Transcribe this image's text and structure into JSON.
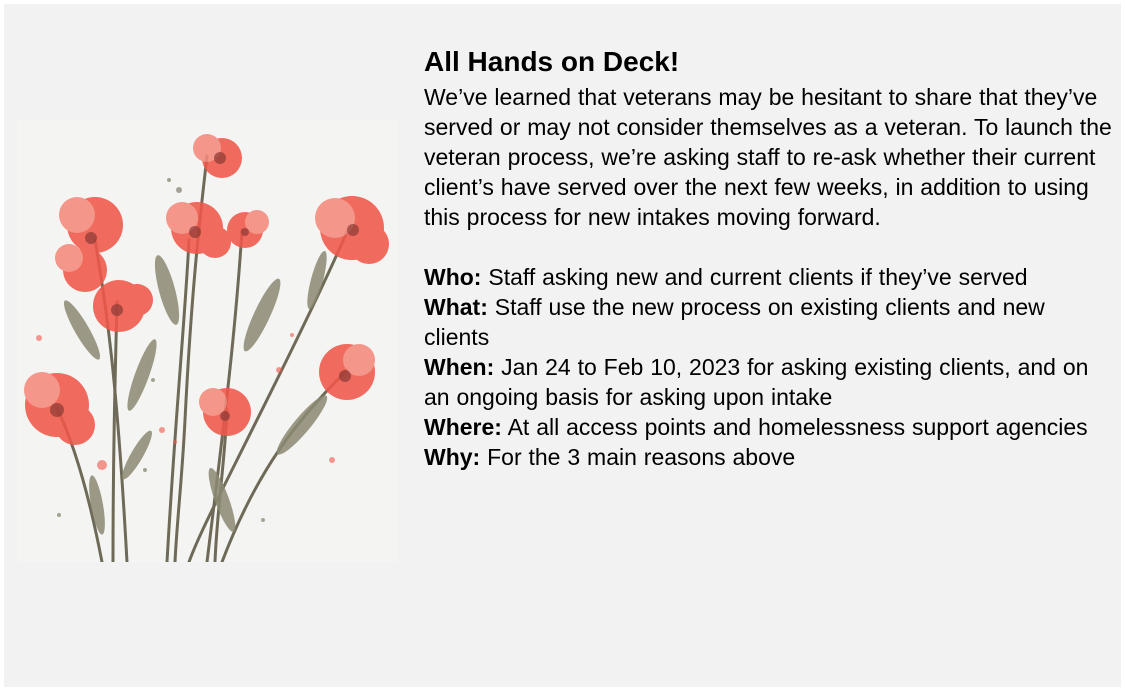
{
  "title": "All Hands on Deck!",
  "intro": "We’ve learned that veterans may be hesitant to share that they’ve served or may not consider themselves as a veteran. To launch the veteran process, we’re asking staff to re-ask whether their current client’s have served over the next few weeks, in addition to using this process for new intakes moving forward.",
  "details": [
    {
      "label": "Who:",
      "text": "Staff asking new and current clients if they’ve served"
    },
    {
      "label": "What:",
      "text": "Staff use the new process on existing clients and new clients"
    },
    {
      "label": "When:",
      "text": "Jan 24 to Feb 10, 2023 for asking existing clients, and on an ongoing basis for asking upon intake"
    },
    {
      "label": "Where:",
      "text": "At all access points and homelessness support agencies"
    },
    {
      "label": "Why:",
      "text": "For the 3 main reasons above"
    }
  ],
  "illustration": {
    "icon": "watercolor-poppies-icon",
    "petal_color": "#f0574a",
    "petal_light": "#f48a7c",
    "center_color": "#8a3a34",
    "stem_color": "#6f6a58"
  }
}
